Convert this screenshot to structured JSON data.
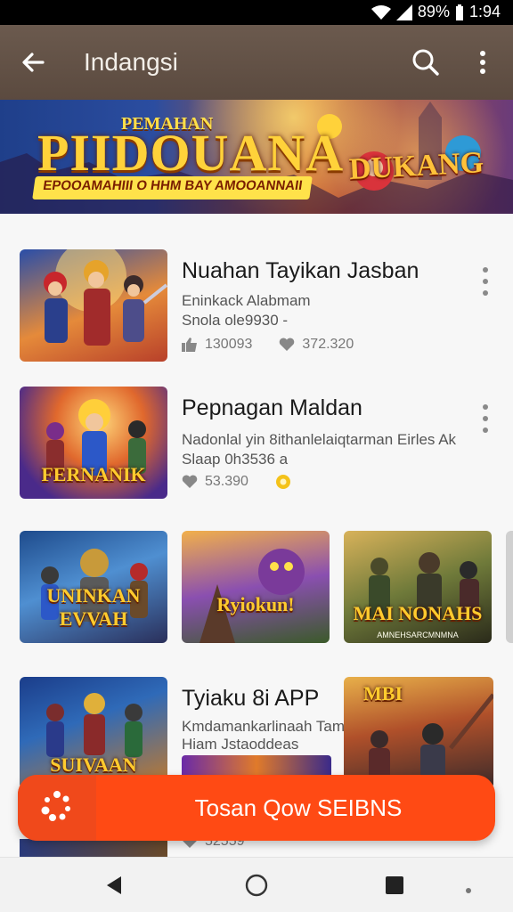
{
  "status_bar": {
    "battery": "89%",
    "time": "1:94"
  },
  "app_bar": {
    "title": "Indangsi"
  },
  "banner": {
    "kicker": "PEMAHAN",
    "title": "PIIDOUANA",
    "strip": "EPOOAMAHIII O HHM BAY AMOOANNAII",
    "logo_text": "DUKANG"
  },
  "list_items": [
    {
      "title": "Nuahan Tayikan Jasban",
      "line1": "Eninkack Alabmam",
      "line2": "Snola ole9930 -",
      "meta_a": "130093",
      "meta_b": "372.320"
    },
    {
      "title": "Pepnagan Maldan",
      "line1": "Nadonlal yin 8ithanlelaiqtarman Eirles Ak",
      "line2": "Slaap 0h3536 a",
      "meta_a": "53.390"
    }
  ],
  "grid": [
    {
      "label": "UNINKAN EVVAH",
      "sub": ""
    },
    {
      "label": "Ryiokun!",
      "sub": ""
    },
    {
      "label": "MAI NONAHS",
      "sub": "AMNEHSARCMNMNA"
    }
  ],
  "third_item": {
    "title": "Tyiaku 8i APP",
    "line1": "Kmdamankarlinaah Tam",
    "line2": "Hiam Jstaoddeas",
    "thumb_label": "SUIVAAN",
    "right_label": "MBI"
  },
  "partial_meta": "52559",
  "cta": {
    "label": "Tosan Qow SEIBNS"
  },
  "colors": {
    "accent": "#ff4a14",
    "appbar": "#5b4a3f"
  }
}
